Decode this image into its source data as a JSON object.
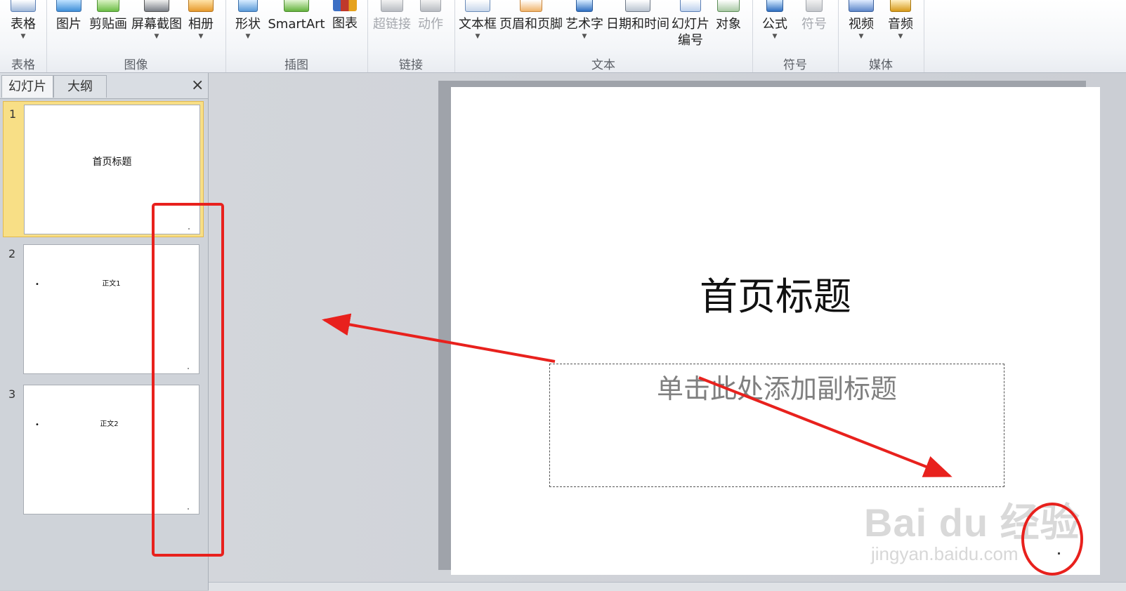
{
  "ribbon": {
    "groups": [
      {
        "label": "表格",
        "buttons": [
          {
            "label": "表格"
          }
        ]
      },
      {
        "label": "图像",
        "buttons": [
          {
            "label": "图片"
          },
          {
            "label": "剪贴画"
          },
          {
            "label": "屏幕截图"
          },
          {
            "label": "相册"
          }
        ]
      },
      {
        "label": "插图",
        "buttons": [
          {
            "label": "形状"
          },
          {
            "label": "SmartArt"
          },
          {
            "label": "图表"
          }
        ]
      },
      {
        "label": "链接",
        "buttons": [
          {
            "label": "超链接"
          },
          {
            "label": "动作"
          }
        ]
      },
      {
        "label": "文本",
        "buttons": [
          {
            "label": "文本框"
          },
          {
            "label": "页眉和页脚"
          },
          {
            "label": "艺术字"
          },
          {
            "label": "日期和时间"
          },
          {
            "label": "幻灯片",
            "label2": "编号"
          },
          {
            "label": "对象"
          }
        ]
      },
      {
        "label": "符号",
        "buttons": [
          {
            "label": "公式"
          },
          {
            "label": "符号"
          }
        ]
      },
      {
        "label": "媒体",
        "buttons": [
          {
            "label": "视频"
          },
          {
            "label": "音频"
          }
        ]
      }
    ]
  },
  "pane": {
    "tabs": [
      {
        "label": "幻灯片"
      },
      {
        "label": "大纲"
      }
    ],
    "close_icon": "×"
  },
  "slides": [
    {
      "number": "1",
      "title": "首页标题",
      "selected": true
    },
    {
      "number": "2",
      "title": "正文1",
      "bullet": "•"
    },
    {
      "number": "3",
      "title": "正文2",
      "bullet": "•"
    }
  ],
  "current_slide": {
    "title": "首页标题",
    "subtitle_placeholder": "单击此处添加副标题"
  },
  "watermark": {
    "brand": "Bai du 经验",
    "url": "jingyan.baidu.com"
  },
  "annotation_color": "#e8211d"
}
